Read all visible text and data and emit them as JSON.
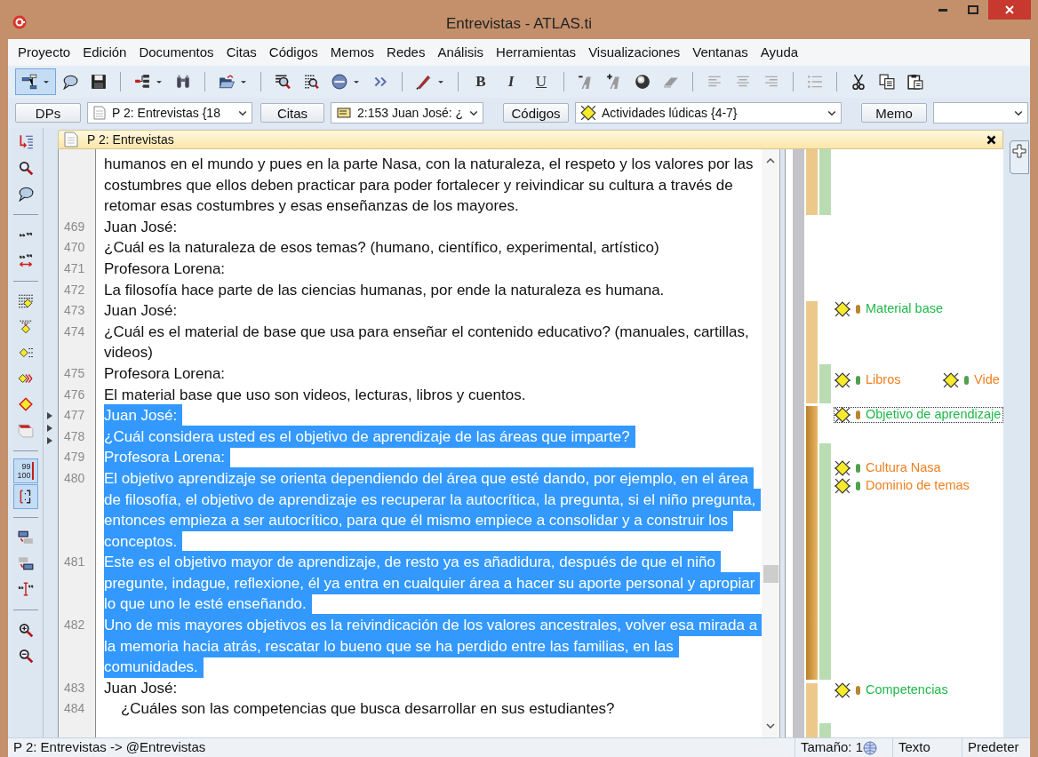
{
  "window": {
    "title": "Entrevistas - ATLAS.ti"
  },
  "menu": [
    "Proyecto",
    "Edición",
    "Documentos",
    "Citas",
    "Códigos",
    "Memos",
    "Redes",
    "Análisis",
    "Herramientas",
    "Visualizaciones",
    "Ventanas",
    "Ayuda"
  ],
  "toolbar": [
    [
      {
        "kind": "network",
        "selected": true,
        "dropdown": true
      },
      {
        "kind": "bubble",
        "selected": false,
        "dropdown": false
      },
      {
        "kind": "save",
        "selected": false,
        "dropdown": false
      }
    ],
    [
      {
        "kind": "tree",
        "selected": false,
        "dropdown": true
      },
      {
        "kind": "binoculars",
        "selected": false,
        "dropdown": false
      }
    ],
    [
      {
        "kind": "folder",
        "selected": false,
        "dropdown": true
      }
    ],
    [
      {
        "kind": "zoomdoc",
        "selected": false,
        "dropdown": false
      },
      {
        "kind": "docsearch",
        "selected": false,
        "dropdown": false
      },
      {
        "kind": "xml",
        "selected": false,
        "dropdown": true
      },
      {
        "kind": "more",
        "selected": false,
        "dropdown": false
      }
    ],
    [
      {
        "kind": "pen",
        "selected": false,
        "dropdown": true
      }
    ],
    [
      {
        "kind": "bold",
        "label": "B",
        "selected": false,
        "dropdown": false
      },
      {
        "kind": "italic",
        "label": "I",
        "selected": false,
        "dropdown": false
      },
      {
        "kind": "underline",
        "label": "U",
        "selected": false,
        "dropdown": false
      }
    ],
    [
      {
        "kind": "minusA",
        "selected": false,
        "dropdown": false
      },
      {
        "kind": "plusA",
        "selected": false,
        "dropdown": false
      },
      {
        "kind": "sphere",
        "selected": false,
        "dropdown": false
      },
      {
        "kind": "eraser",
        "selected": false,
        "dropdown": false
      }
    ],
    [
      {
        "kind": "alignleft",
        "selected": false,
        "dropdown": false
      },
      {
        "kind": "aligncenter",
        "selected": false,
        "dropdown": false
      },
      {
        "kind": "alignright",
        "selected": false,
        "dropdown": false
      }
    ],
    [
      {
        "kind": "list",
        "selected": false,
        "dropdown": false
      }
    ],
    [
      {
        "kind": "scissors",
        "selected": false,
        "dropdown": false
      },
      {
        "kind": "copy",
        "selected": false,
        "dropdown": false
      },
      {
        "kind": "paste",
        "selected": false,
        "dropdown": false
      }
    ]
  ],
  "selectors": [
    {
      "kind": "button",
      "label": "DPs"
    },
    {
      "kind": "combo",
      "value": "P 2: Entrevistas {18"
    },
    {
      "kind": "button",
      "label": "Citas"
    },
    {
      "kind": "combo",
      "value": "2:153 Juan José: ¿"
    },
    {
      "kind": "button",
      "label": "Códigos"
    },
    {
      "kind": "combo",
      "value": "Actividades lúdicas {4-7}"
    },
    {
      "kind": "button",
      "label": "Memo"
    },
    {
      "kind": "combo"
    }
  ],
  "side_toolbar": [
    [
      {
        "kind": "jump",
        "selected": false
      },
      {
        "kind": "search",
        "selected": false
      },
      {
        "kind": "bubble",
        "selected": false
      }
    ],
    [
      {
        "kind": "quote",
        "selected": false
      },
      {
        "kind": "quotearrows",
        "selected": false
      }
    ],
    [
      {
        "kind": "code1",
        "selected": false
      },
      {
        "kind": "code2",
        "selected": false
      },
      {
        "kind": "code3",
        "selected": false
      },
      {
        "kind": "code4",
        "selected": false
      },
      {
        "kind": "code5",
        "selected": false
      },
      {
        "kind": "memo",
        "selected": false
      }
    ],
    [
      {
        "kind": "linenumbers",
        "label": [
          "99",
          "100"
        ],
        "selected": true
      },
      {
        "kind": "margin",
        "selected": true
      }
    ],
    [
      {
        "kind": "win1",
        "selected": false
      },
      {
        "kind": "win2",
        "selected": false
      },
      {
        "kind": "quotebeam",
        "selected": false
      }
    ],
    [
      {
        "kind": "zoomin",
        "selected": false
      },
      {
        "kind": "zoomout",
        "selected": false
      }
    ]
  ],
  "document": {
    "title": "P 2: Entrevistas",
    "paragraphs": [
      {
        "lines": [
          "humanos en el mundo y pues en la parte Nasa, con la naturaleza, el respeto y los valores por las",
          "costumbres que ellos deben practicar para poder fortalecer y reivindicar su cultura a través de",
          "retomar esas costumbres y esas enseñanzas de los mayores."
        ],
        "selected": false
      },
      {
        "number": "469",
        "lines": [
          "Juan José:"
        ],
        "selected": false
      },
      {
        "number": "470",
        "lines": [
          "¿Cuál es la naturaleza de esos temas? (humano, científico, experimental, artístico)"
        ],
        "selected": false
      },
      {
        "number": "471",
        "lines": [
          "Profesora Lorena:"
        ],
        "selected": false
      },
      {
        "number": "472",
        "lines": [
          "La filosofía hace parte de las ciencias humanas, por ende la naturaleza es humana."
        ],
        "selected": false
      },
      {
        "number": "473",
        "lines": [
          "Juan José:"
        ],
        "selected": false
      },
      {
        "number": "474",
        "lines": [
          "¿Cuál es el material de base que usa para enseñar el contenido educativo? (manuales, cartillas,",
          "videos)"
        ],
        "selected": false
      },
      {
        "number": "475",
        "lines": [
          "Profesora Lorena:"
        ],
        "selected": false
      },
      {
        "number": "476",
        "lines": [
          "El material base que uso son videos, lecturas, libros y cuentos."
        ],
        "selected": false
      },
      {
        "number": "477",
        "lines": [
          "Juan José:"
        ],
        "selected": true
      },
      {
        "number": "478",
        "lines": [
          "¿Cuál considera usted es el objetivo de aprendizaje de las áreas que imparte?"
        ],
        "selected": true
      },
      {
        "number": "479",
        "lines": [
          "Profesora Lorena:"
        ],
        "selected": true
      },
      {
        "number": "480",
        "lines": [
          "El objetivo aprendizaje se orienta dependiendo del área que esté dando, por ejemplo, en el área",
          "de filosofía, el objetivo de aprendizaje es recuperar la autocrítica, la pregunta, si el niño pregunta,",
          "entonces empieza a ser autocrítico, para que él mismo empiece a consolidar y a construir los",
          "conceptos."
        ],
        "selected": true
      },
      {
        "number": "481",
        "lines": [
          "Este es el objetivo mayor de aprendizaje, de resto ya es añadidura, después de que el niño",
          "pregunte, indague, reflexione, él ya entra en cualquier área a hacer su aporte personal y apropiar",
          "lo que uno le esté enseñando."
        ],
        "selected": true
      },
      {
        "number": "482",
        "lines": [
          "Uno de mis mayores objetivos es la reivindicación de los valores ancestrales, volver esa mirada a",
          "la memoria hacia atrás, rescatar lo bueno que se ha perdido entre las familias, en las",
          "comunidades."
        ],
        "selected": true
      },
      {
        "number": "483",
        "lines": [
          "Juan José:"
        ],
        "selected": false
      },
      {
        "number": "484",
        "lines": [
          "    ¿Cuáles son las competencias que busca desarrollar en sus estudiantes?"
        ],
        "selected": false
      }
    ]
  },
  "margin_codes": [
    {
      "label": "Material base",
      "kind": "primary",
      "color": "#b8862e",
      "focused": false
    },
    {
      "label": "Libros",
      "kind": "secondary",
      "color": "#4ea24a",
      "focused": false
    },
    {
      "label": "Vide",
      "kind": "secondary",
      "color": "#4ea24a",
      "focused": false
    },
    {
      "label": "Objetivo de aprendizaje",
      "kind": "primary",
      "color": "#b8862e",
      "focused": true
    },
    {
      "label": "Cultura Nasa",
      "kind": "secondary",
      "color": "#4ea24a",
      "focused": false
    },
    {
      "label": "Dominio de temas",
      "kind": "secondary",
      "color": "#4ea24a",
      "focused": false
    },
    {
      "label": "Competencias",
      "kind": "primary",
      "color": "#b8862e",
      "focused": false
    }
  ],
  "status_bar": {
    "path": "P 2: Entrevistas -> @Entrevistas",
    "size": "Tamaño: 1",
    "mode": "Texto",
    "style": "Predeter"
  }
}
